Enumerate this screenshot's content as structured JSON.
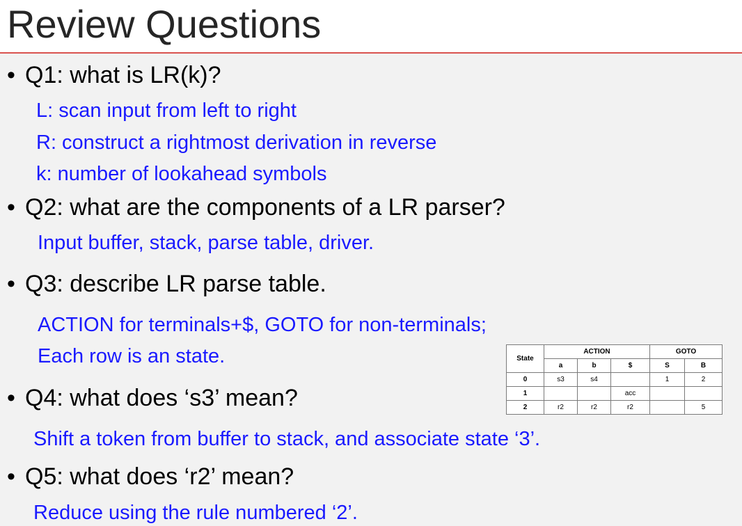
{
  "title": "Review Questions",
  "questions": [
    {
      "q": "Q1: what is LR(k)?",
      "answers": [
        "L: scan input from left to right",
        "R: construct a rightmost derivation in reverse",
        "k: number of lookahead symbols"
      ]
    },
    {
      "q": "Q2: what are the components of a LR parser?",
      "answers": [
        "Input buffer, stack, parse table, driver."
      ]
    },
    {
      "q": "Q3: describe LR parse table.",
      "answers": [
        "ACTION for terminals+$, GOTO for non-terminals;",
        "Each row is an state."
      ]
    },
    {
      "q": "Q4: what does ‘s3’ mean?",
      "answers": [
        "Shift a token from buffer to stack, and associate state ‘3’."
      ]
    },
    {
      "q": "Q5: what does ‘r2’ mean?",
      "answers": [
        "Reduce using the rule numbered ‘2’."
      ]
    }
  ],
  "table": {
    "state_header": "State",
    "action_header": "ACTION",
    "goto_header": "GOTO",
    "columns": [
      "a",
      "b",
      "$",
      "S",
      "B"
    ],
    "rows": [
      {
        "state": "0",
        "cells": [
          "s3",
          "s4",
          "",
          "1",
          "2"
        ]
      },
      {
        "state": "1",
        "cells": [
          "",
          "",
          "acc",
          "",
          ""
        ]
      },
      {
        "state": "2",
        "cells": [
          "r2",
          "r2",
          "r2",
          "",
          "5"
        ]
      }
    ]
  },
  "colors": {
    "question": "#000000",
    "answer": "#1a1aff",
    "rule": "#d9534f"
  }
}
